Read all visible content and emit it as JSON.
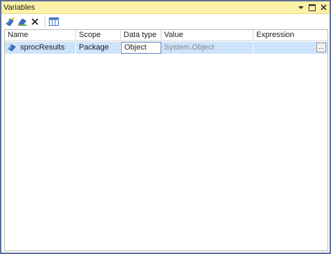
{
  "window": {
    "title": "Variables"
  },
  "toolbar": {
    "buttons": [
      {
        "icon": "add-variable-icon"
      },
      {
        "icon": "move-variable-icon"
      },
      {
        "icon": "delete-variable-icon"
      },
      {
        "icon": "grid-options-icon"
      }
    ]
  },
  "grid": {
    "columns": [
      "Name",
      "Scope",
      "Data type",
      "Value",
      "Expression"
    ],
    "rows": [
      {
        "name": "sprocResults",
        "scope": "Package",
        "data_type": "Object",
        "value": "System.Object",
        "expression": "",
        "expression_button": "..."
      }
    ]
  },
  "colors": {
    "titlebar": "#fdf1a7",
    "selected_row": "#cde3fb",
    "border": "#5b6f99"
  }
}
